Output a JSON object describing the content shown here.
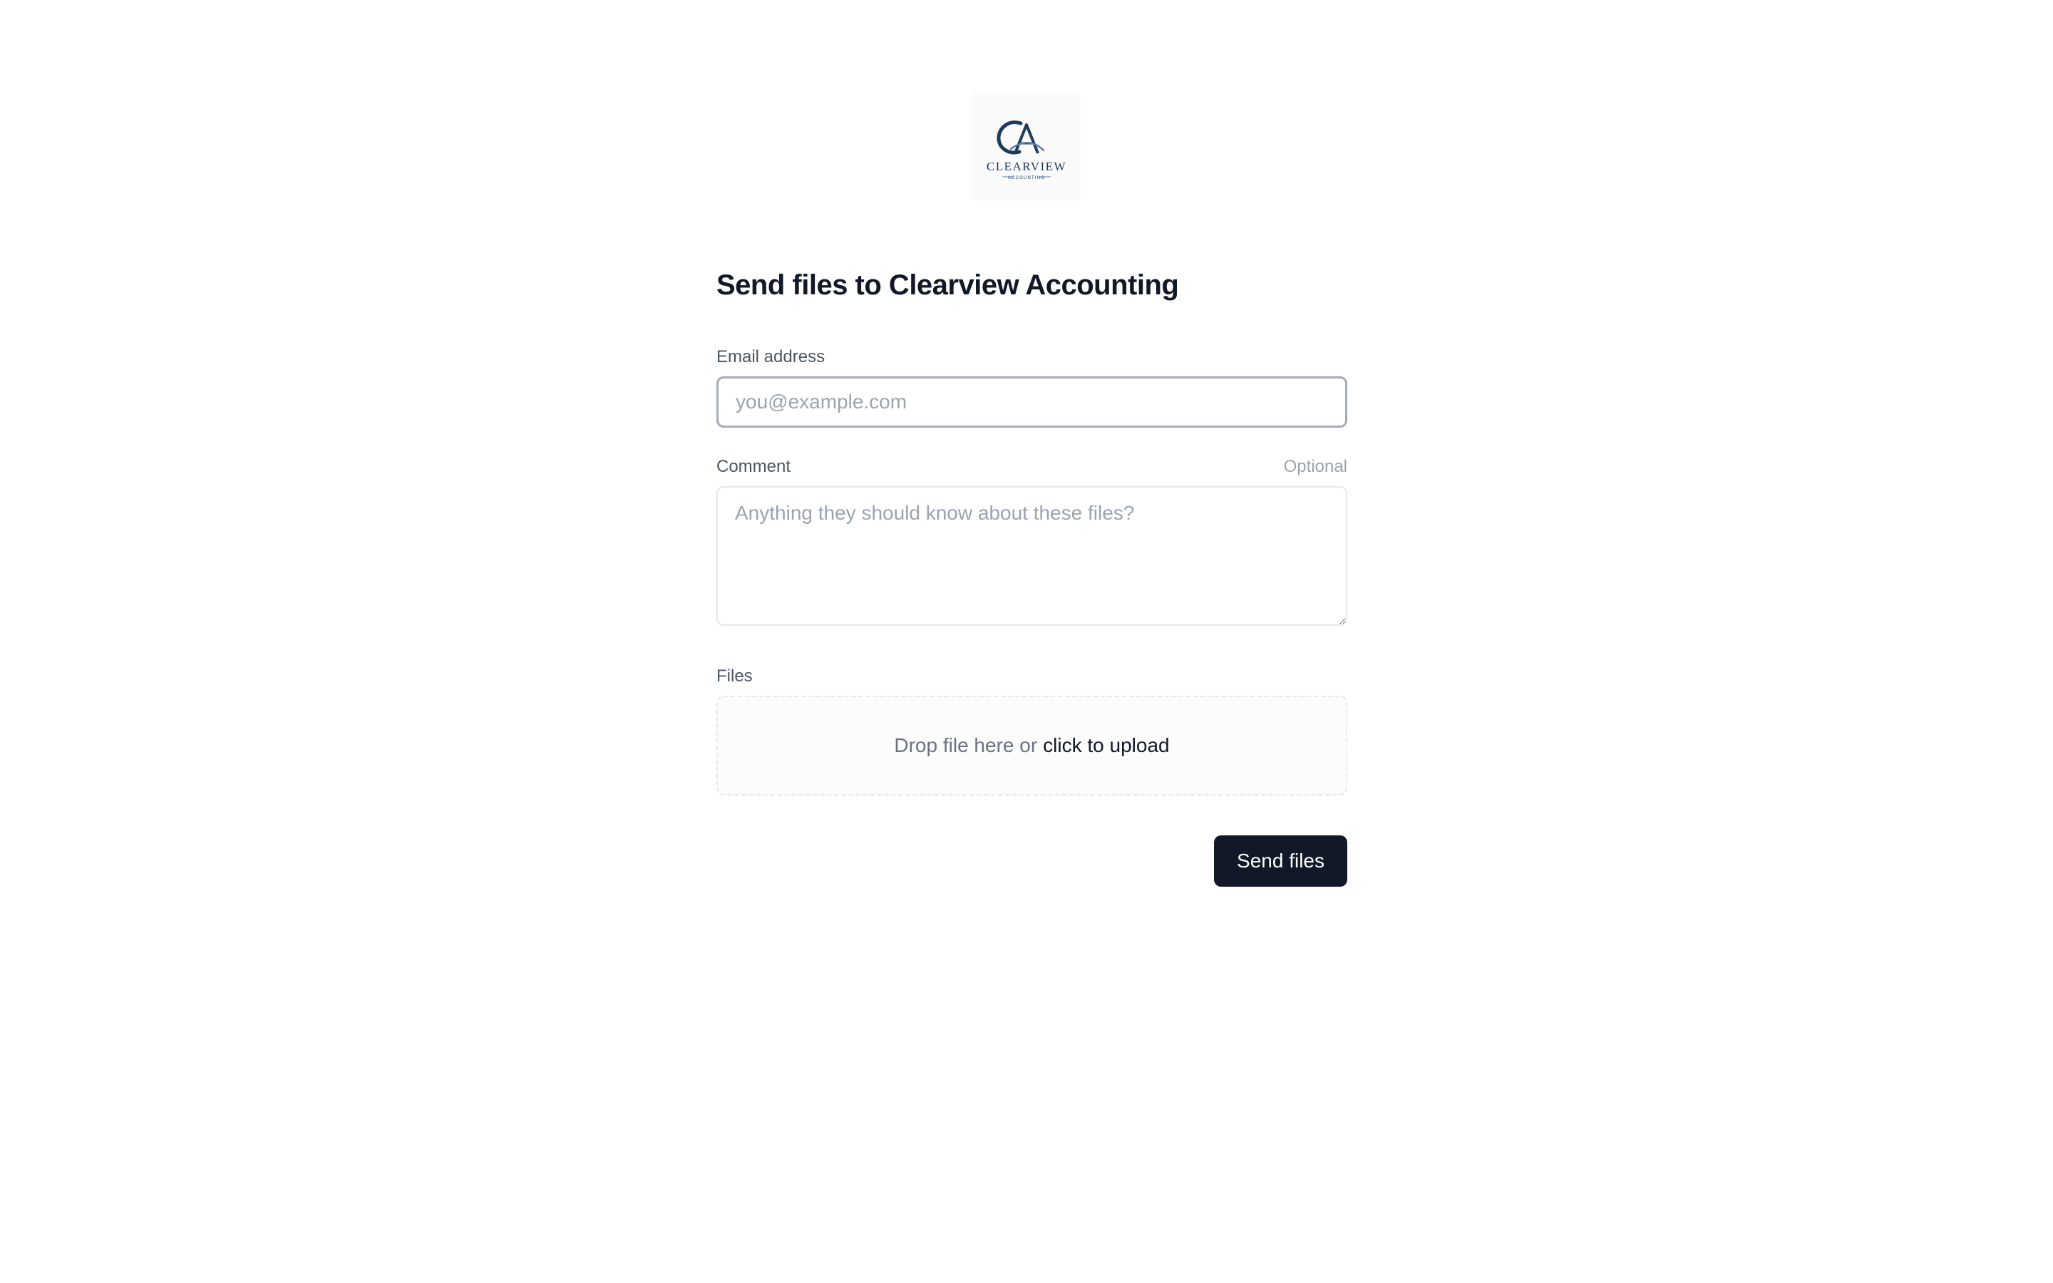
{
  "brand": {
    "logo_icon": "clearview-accounting-logo",
    "logo_text": "CLEARVIEW",
    "logo_subtext": "ACCOUNTING",
    "primary_color": "#1e3a5f"
  },
  "form": {
    "title": "Send files to Clearview Accounting",
    "email": {
      "label": "Email address",
      "placeholder": "you@example.com",
      "value": ""
    },
    "comment": {
      "label": "Comment",
      "optional_label": "Optional",
      "placeholder": "Anything they should know about these files?",
      "value": ""
    },
    "files": {
      "label": "Files",
      "drop_text": "Drop file here or",
      "upload_link": "click to upload"
    },
    "submit_label": "Send files"
  }
}
